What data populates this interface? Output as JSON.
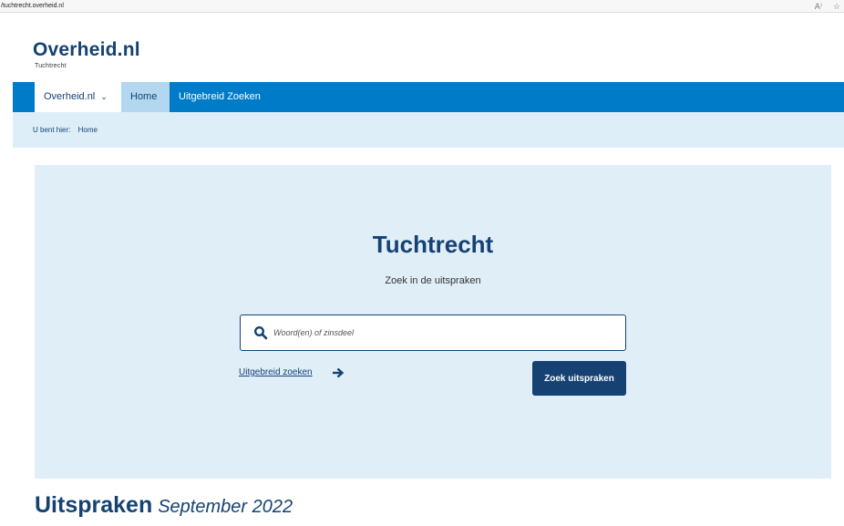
{
  "browser": {
    "url": "/tuchtrecht.overheid.nl",
    "read_aloud_icon": "A⁾",
    "favorite_icon": "☆"
  },
  "header": {
    "logo_text": "Overheid",
    "logo_dot": ".",
    "logo_suffix": "nl",
    "logo_sub": "Tuchtrecht"
  },
  "nav": {
    "items": [
      {
        "label": "Overheid.nl"
      },
      {
        "label": "Home"
      },
      {
        "label": "Uitgebreid Zoeken"
      }
    ]
  },
  "breadcrumb": {
    "prefix": "U bent hier:",
    "current": "Home"
  },
  "hero": {
    "title": "Tuchtrecht",
    "subtitle": "Zoek in de uitspraken",
    "search_placeholder": "Woord(en) of zinsdeel",
    "advanced_link": "Uitgebreid zoeken",
    "search_button": "Zoek uitspraken"
  },
  "uitspraken": {
    "title": "Uitspraken",
    "period": "September 2022"
  },
  "colors": {
    "brand_dark": "#154273",
    "brand_blue": "#007bc7",
    "hero_bg": "#e0eef8",
    "breadcrumb_bg": "#ddeef8"
  }
}
